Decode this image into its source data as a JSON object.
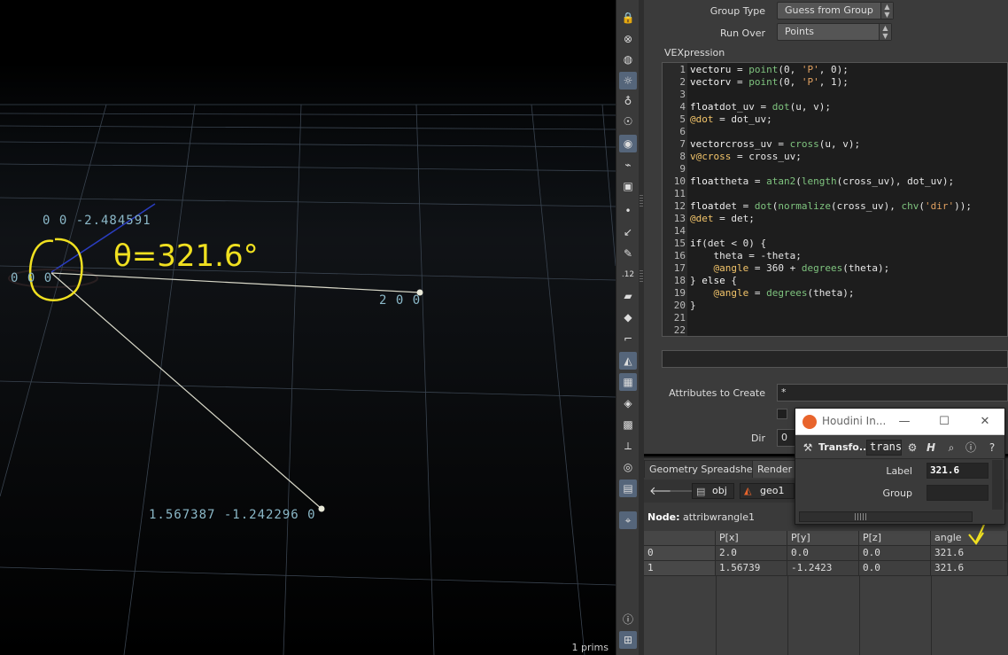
{
  "viewport": {
    "labels": {
      "top_point": "0 0 -2.484591",
      "origin": "0 0 0",
      "right_point": "2 0 0",
      "bottom_point": "1.567387 -1.242296 0"
    },
    "annotation": "θ=321.6°",
    "status": "1  prims"
  },
  "shelf": {
    "tools": [
      "lock-icon",
      "close-circle-icon",
      "sphere-icon",
      "light-bulb-icon",
      "light-icon",
      "point-light-icon",
      "camera-icon",
      "flashlight-icon",
      "camera-rig-icon",
      "dot-icon",
      "arrow-icon",
      "pen-icon",
      "number-12-icon",
      "paint-icon",
      "brush-icon",
      "corner-icon",
      "view-icon",
      "checker-icon",
      "diamond-icon",
      "cube-icon",
      "axis-icon",
      "circle-icon",
      "snapshot-icon",
      "pin-icon",
      "info-icon",
      "grid-icon"
    ]
  },
  "params": {
    "group_type_label": "Group Type",
    "group_type_value": "Guess from Group",
    "run_over_label": "Run Over",
    "run_over_value": "Points",
    "vex_label": "VEXpression",
    "line_numbers": [
      "1",
      "2",
      "3",
      "4",
      "5",
      "6",
      "7",
      "8",
      "9",
      "10",
      "11",
      "12",
      "13",
      "14",
      "15",
      "16",
      "17",
      "18",
      "19",
      "20",
      "21",
      "22"
    ],
    "attributes_label": "Attributes to Create",
    "attributes_value": "*",
    "dir_label": "Dir",
    "dir_value": "0"
  },
  "bottom": {
    "tabs": [
      "Geometry Spreadsheet",
      "Render Sc"
    ],
    "tab_close": "×",
    "crumbs": [
      "obj",
      "geo1"
    ],
    "node_label": "Node:",
    "node_name": "attribwrangle1",
    "columns": [
      "",
      "P[x]",
      "P[y]",
      "P[z]",
      "angle"
    ],
    "rows": [
      [
        "0",
        "2.0",
        "0.0",
        "0.0",
        "321.6"
      ],
      [
        "1",
        "1.56739",
        "-1.2423",
        "0.0",
        "321.6"
      ]
    ]
  },
  "float_window": {
    "title": "Houdini In...",
    "node_type": "Transfo...",
    "search_value": "trans",
    "label_label": "Label",
    "label_value": "321.6",
    "group_label": "Group"
  },
  "colors": {
    "annotation": "#f0e020",
    "viewport_text": "#8bb8c8",
    "panel": "#3b3b3b"
  }
}
